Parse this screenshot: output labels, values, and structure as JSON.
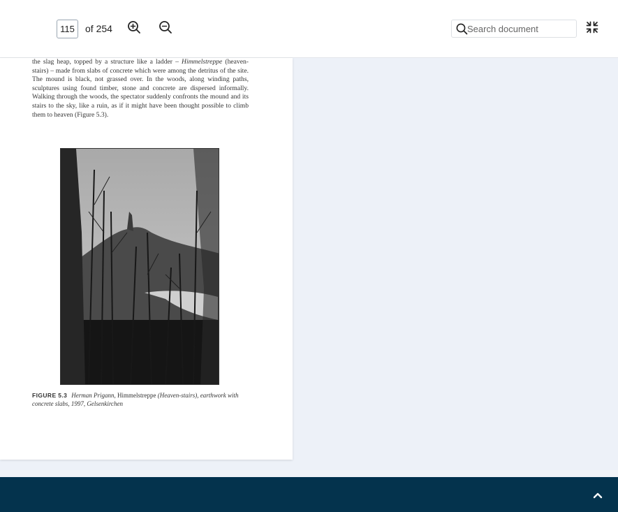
{
  "toolbar": {
    "page_number": "115",
    "page_total_label": "of 254",
    "zoom_in_icon": "zoom-in-icon",
    "zoom_out_icon": "zoom-out-icon",
    "search_placeholder": "Search document",
    "collapse_icon": "collapse-icon"
  },
  "document": {
    "para_lead": "the slag heap, topped by a structure like a ladder – ",
    "para_term": "Himmelstreppe",
    "para_rest": " (heaven-stairs) – made from slabs of concrete which were among the detritus of the site. The mound is black, not grassed over. In the woods, along winding paths, sculptures using found timber, stone and concrete are dispersed informally. Walking through the woods, the spectator suddenly confronts the mound and its stairs to the sky, like a ruin, as if it might have been thought possible to climb them to heaven (Figure 5.3).",
    "figure_label": "FIGURE 5.3",
    "caption_artist": "Herman Prigann, ",
    "caption_work": "Himmelstreppe",
    "caption_rest": " (Heaven-stairs), earthwork with concrete slabs, 1997, Gelsenkirchen"
  },
  "footer": {
    "scroll_top_icon": "chevron-up-icon"
  },
  "colors": {
    "footer_bg": "#04334d",
    "viewer_bg": "#edf1f8"
  }
}
